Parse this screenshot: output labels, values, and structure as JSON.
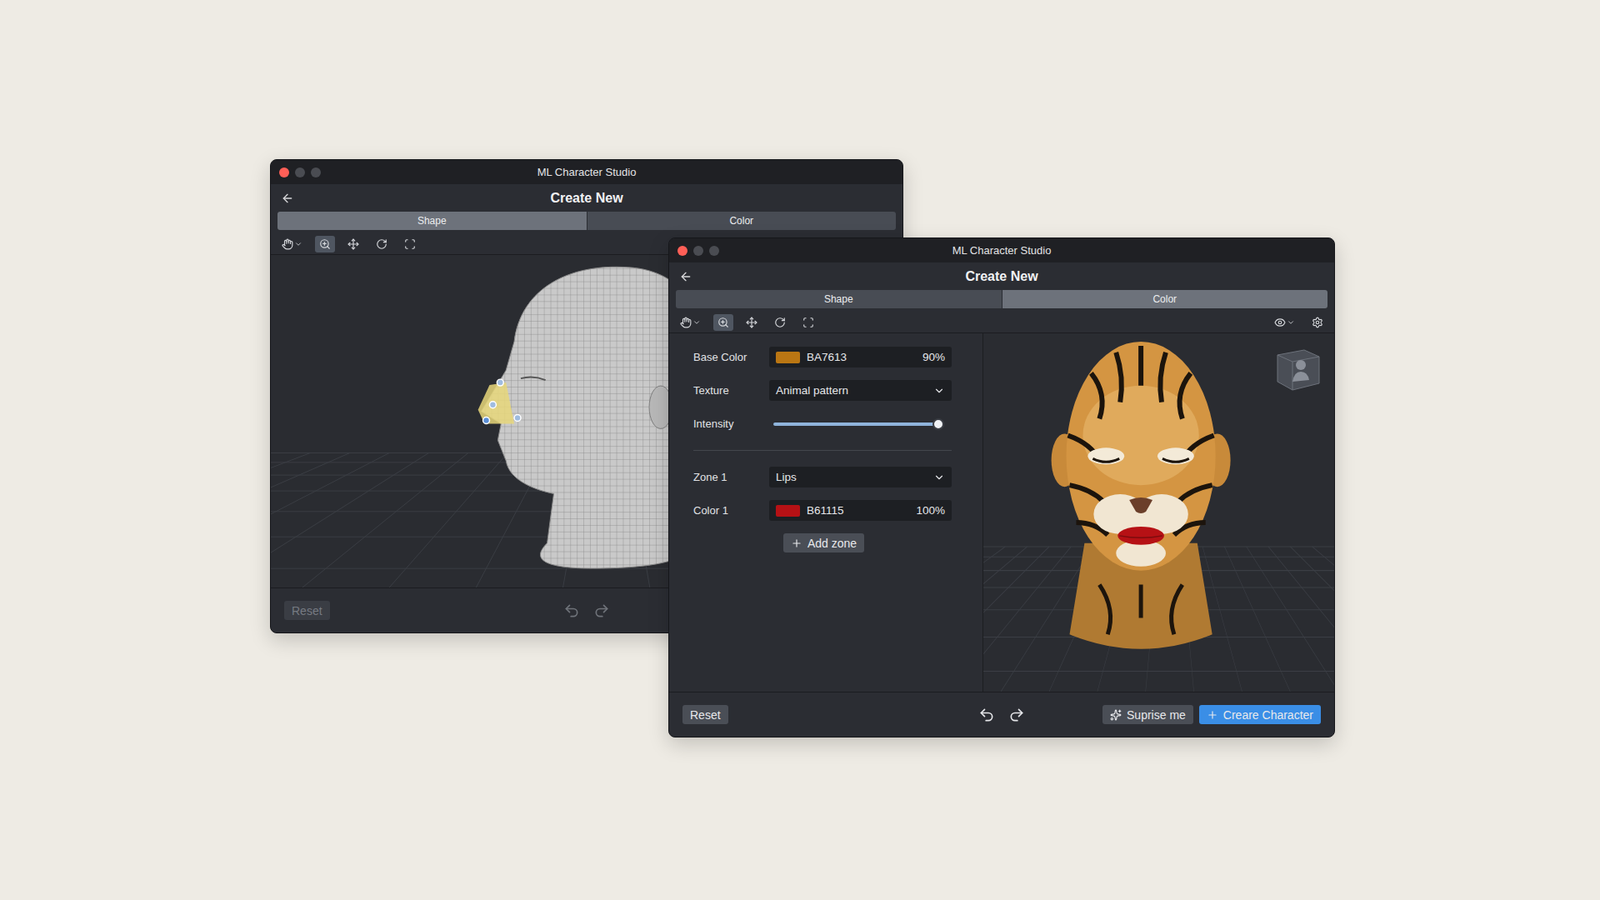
{
  "windows": [
    {
      "title": "ML Character Studio",
      "header": "Create New",
      "tabs": [
        {
          "label": "Shape",
          "selected": true
        },
        {
          "label": "Color",
          "selected": false
        }
      ],
      "tools": [
        {
          "kind": "pan",
          "selected": false
        },
        {
          "kind": "zoom",
          "selected": true
        },
        {
          "kind": "move",
          "selected": false
        },
        {
          "kind": "rotate",
          "selected": false
        },
        {
          "kind": "frame",
          "selected": false
        }
      ],
      "viewport": {
        "kind": "wireframe"
      },
      "footer": {
        "reset": {
          "label": "Reset",
          "disabled": true
        },
        "undo_disabled": true,
        "redo_disabled": true,
        "actions": []
      }
    },
    {
      "title": "ML Character Studio",
      "header": "Create New",
      "tabs": [
        {
          "label": "Shape",
          "selected": false
        },
        {
          "label": "Color",
          "selected": true
        }
      ],
      "tools": [
        {
          "kind": "pan",
          "selected": false
        },
        {
          "kind": "zoom",
          "selected": true
        },
        {
          "kind": "move",
          "selected": false
        },
        {
          "kind": "rotate",
          "selected": false
        },
        {
          "kind": "frame",
          "selected": false
        }
      ],
      "viewport": {
        "kind": "textured"
      },
      "form": {
        "base_color": {
          "label": "Base Color",
          "value": "BA7613",
          "opacity": "90%",
          "color": "#BA7613"
        },
        "texture": {
          "label": "Texture",
          "value": "Animal pattern"
        },
        "intensity": {
          "label": "Intensity",
          "level": 0.97
        },
        "zones": [
          {
            "zone_label": "Zone 1",
            "zone_value": "Lips",
            "color_label": "Color 1",
            "value": "B61115",
            "opacity": "100%",
            "color": "#B61115"
          }
        ],
        "add_zone": "Add zone"
      },
      "footer": {
        "reset": {
          "label": "Reset",
          "disabled": false
        },
        "undo_disabled": false,
        "redo_disabled": false,
        "actions": [
          {
            "label": "Suprise me",
            "kind": "secondary"
          },
          {
            "label": "Creare Character",
            "kind": "primary"
          }
        ]
      }
    }
  ]
}
